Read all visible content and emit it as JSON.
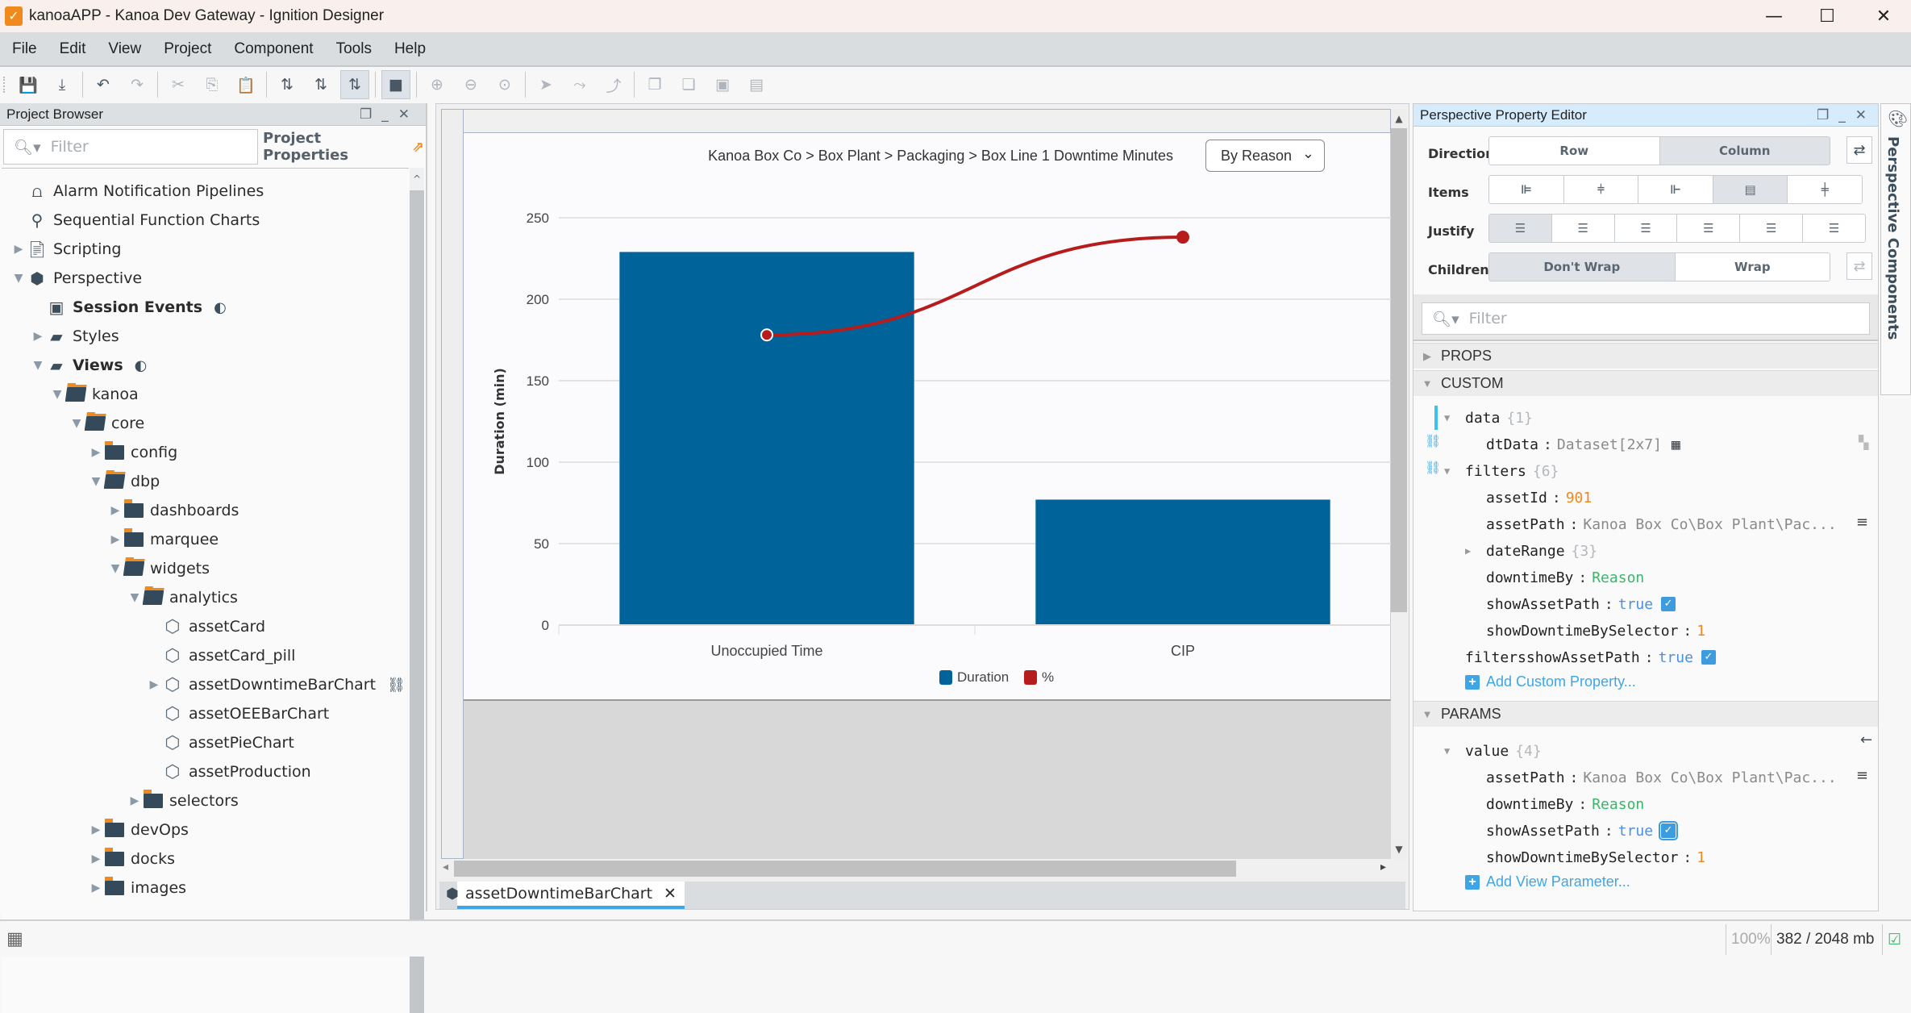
{
  "window": {
    "title": "kanoaAPP - Kanoa Dev Gateway - Ignition Designer",
    "controls": [
      "minimize-icon",
      "maximize-icon",
      "close-icon"
    ]
  },
  "menu": [
    "File",
    "Edit",
    "View",
    "Project",
    "Component",
    "Tools",
    "Help"
  ],
  "toolbar": {
    "groups": [
      [
        {
          "icon": "save-icon",
          "glyph": "💾"
        },
        {
          "icon": "save-download-icon",
          "glyph": "⤓"
        }
      ],
      [
        {
          "icon": "undo-icon",
          "glyph": "↶"
        },
        {
          "icon": "redo-icon",
          "glyph": "↷",
          "disabled": true
        }
      ],
      [
        {
          "icon": "cut-icon",
          "glyph": "✂",
          "disabled": true
        },
        {
          "icon": "copy-icon",
          "glyph": "⎘",
          "disabled": true
        },
        {
          "icon": "paste-icon",
          "glyph": "📋",
          "disabled": true
        }
      ],
      [
        {
          "icon": "binding-off-icon",
          "glyph": "⇅"
        },
        {
          "icon": "preview-mode-icon",
          "glyph": "⇅"
        },
        {
          "icon": "design-mode-icon",
          "glyph": "⇅",
          "active": true
        }
      ],
      [
        {
          "icon": "stop-icon",
          "glyph": "■",
          "active": true
        }
      ],
      [
        {
          "icon": "zoom-in-icon",
          "glyph": "⊕",
          "disabled": true
        },
        {
          "icon": "zoom-out-icon",
          "glyph": "⊖",
          "disabled": true
        },
        {
          "icon": "zoom-fit-icon",
          "glyph": "⊙",
          "disabled": true
        }
      ],
      [
        {
          "icon": "pointer-icon",
          "glyph": "➤",
          "disabled": true
        },
        {
          "icon": "connect-icon",
          "glyph": "⤳",
          "disabled": true
        },
        {
          "icon": "route-icon",
          "glyph": "⤴",
          "disabled": true
        }
      ],
      [
        {
          "icon": "bring-front-icon",
          "glyph": "❐",
          "disabled": true
        },
        {
          "icon": "send-back-icon",
          "glyph": "❏",
          "disabled": true
        },
        {
          "icon": "layer-up-icon",
          "glyph": "▣",
          "disabled": true
        },
        {
          "icon": "layer-down-icon",
          "glyph": "▤",
          "disabled": true
        }
      ]
    ]
  },
  "project_browser": {
    "title": "Project Browser",
    "filter_placeholder": "Filter",
    "project_properties_label": "Project Properties",
    "tree": [
      {
        "label": "Alarm Notification Pipelines",
        "depth": 0,
        "icon": "alarm-pipeline-icon",
        "arrow": ""
      },
      {
        "label": "Sequential Function Charts",
        "depth": 0,
        "icon": "sfc-icon",
        "arrow": ""
      },
      {
        "label": "Scripting",
        "depth": 0,
        "icon": "scripting-icon",
        "arrow": "collapsed"
      },
      {
        "label": "Perspective",
        "depth": 0,
        "icon": "perspective-icon",
        "arrow": "expanded"
      },
      {
        "label": "Session Events",
        "depth": 1,
        "icon": "session-events-icon",
        "arrow": "",
        "bold": true,
        "badge": true
      },
      {
        "label": "Styles",
        "depth": 1,
        "icon": "styles-folder-icon",
        "arrow": "collapsed"
      },
      {
        "label": "Views",
        "depth": 1,
        "icon": "views-folder-icon",
        "arrow": "expanded",
        "bold": true,
        "badge": true
      },
      {
        "label": "kanoa",
        "depth": 2,
        "icon": "folder-open-icon",
        "arrow": "expanded"
      },
      {
        "label": "core",
        "depth": 3,
        "icon": "folder-open-icon",
        "arrow": "expanded"
      },
      {
        "label": "config",
        "depth": 4,
        "icon": "folder-icon",
        "arrow": "collapsed"
      },
      {
        "label": "dbp",
        "depth": 4,
        "icon": "folder-open-icon",
        "arrow": "expanded"
      },
      {
        "label": "dashboards",
        "depth": 5,
        "icon": "folder-icon",
        "arrow": "collapsed"
      },
      {
        "label": "marquee",
        "depth": 5,
        "icon": "folder-icon",
        "arrow": "collapsed"
      },
      {
        "label": "widgets",
        "depth": 5,
        "icon": "folder-open-icon",
        "arrow": "expanded"
      },
      {
        "label": "analytics",
        "depth": 6,
        "icon": "folder-open-icon",
        "arrow": "expanded"
      },
      {
        "label": "assetCard",
        "depth": 7,
        "icon": "view-icon",
        "arrow": ""
      },
      {
        "label": "assetCard_pill",
        "depth": 7,
        "icon": "view-icon",
        "arrow": ""
      },
      {
        "label": "assetDowntimeBarChart",
        "depth": 7,
        "icon": "view-edit-icon",
        "arrow": "collapsed",
        "link": true
      },
      {
        "label": "assetOEEBarChart",
        "depth": 7,
        "icon": "view-icon",
        "arrow": ""
      },
      {
        "label": "assetPieChart",
        "depth": 7,
        "icon": "view-icon",
        "arrow": ""
      },
      {
        "label": "assetProduction",
        "depth": 7,
        "icon": "view-icon",
        "arrow": ""
      },
      {
        "label": "selectors",
        "depth": 6,
        "icon": "folder-icon",
        "arrow": "collapsed"
      },
      {
        "label": "devOps",
        "depth": 4,
        "icon": "folder-icon",
        "arrow": "collapsed"
      },
      {
        "label": "docks",
        "depth": 4,
        "icon": "folder-icon",
        "arrow": "collapsed"
      },
      {
        "label": "images",
        "depth": 4,
        "icon": "folder-icon",
        "arrow": "collapsed"
      }
    ]
  },
  "canvas": {
    "chart_title": "Kanoa Box Co > Box Plant > Packaging > Box Line 1 Downtime Minutes",
    "dropdown_value": "By Reason",
    "open_tab": "assetDowntimeBarChart"
  },
  "chart_data": {
    "type": "bar",
    "title": "Kanoa Box Co > Box Plant > Packaging > Box Line 1 Downtime Minutes",
    "categories": [
      "Unoccupied Time",
      "CIP"
    ],
    "series": [
      {
        "name": "Duration",
        "type": "bar",
        "color": "#006399",
        "values": [
          229,
          77
        ]
      },
      {
        "name": "%",
        "type": "line",
        "color": "#b71c1c",
        "axis": "secondary",
        "values": [
          74.8,
          100
        ]
      }
    ],
    "xlabel": "",
    "ylabel": "Duration (min)",
    "ylim": [
      0,
      250
    ],
    "yticks": [
      0,
      50,
      100,
      150,
      200,
      250
    ],
    "y2lim": [
      0,
      105
    ],
    "grid": true,
    "legend": "bottom"
  },
  "property_editor": {
    "title": "Perspective Property Editor",
    "direction": {
      "label": "Direction",
      "options": [
        "Row",
        "Column"
      ],
      "selected": "Column"
    },
    "items": {
      "label": "Items",
      "options": [
        "align-start-icon",
        "align-center-icon",
        "align-end-icon",
        "align-stretch-icon",
        "align-baseline-icon"
      ],
      "selected": 3
    },
    "justify": {
      "label": "Justify",
      "options": [
        "justify-start-icon",
        "justify-center-icon",
        "justify-end-icon",
        "justify-between-icon",
        "justify-around-icon",
        "justify-evenly-icon"
      ],
      "selected": 0
    },
    "children": {
      "label": "Children",
      "options": [
        "Don't Wrap",
        "Wrap"
      ],
      "selected": "Don't Wrap"
    },
    "filter_placeholder": "Filter",
    "sections": {
      "props": "PROPS",
      "custom": "CUSTOM",
      "params": "PARAMS"
    },
    "custom": {
      "data_key": "data",
      "data_count": "{1}",
      "dtData_key": "dtData",
      "dtData_value": "Dataset[2x7]",
      "filters_key": "filters",
      "filters_count": "{6}",
      "assetId_key": "assetId",
      "assetId_value": "901",
      "assetPath_key": "assetPath",
      "assetPath_value": "Kanoa Box Co\\Box Plant\\Pac...",
      "dateRange_key": "dateRange",
      "dateRange_count": "{3}",
      "downtimeBy_key": "downtimeBy",
      "downtimeBy_value": "Reason",
      "showAssetPath_key": "showAssetPath",
      "showAssetPath_value": "true",
      "showDowntimeBySelector_key": "showDowntimeBySelector",
      "showDowntimeBySelector_value": "1",
      "filtersshowAssetPath_key": "filtersshowAssetPath",
      "filtersshowAssetPath_value": "true",
      "add_label": "Add Custom Property..."
    },
    "params": {
      "value_key": "value",
      "value_count": "{4}",
      "assetPath_key": "assetPath",
      "assetPath_value": "Kanoa Box Co\\Box Plant\\Pac...",
      "downtimeBy_key": "downtimeBy",
      "downtimeBy_value": "Reason",
      "showAssetPath_key": "showAssetPath",
      "showAssetPath_value": "true",
      "showDowntimeBySelector_key": "showDowntimeBySelector",
      "showDowntimeBySelector_value": "1",
      "add_label": "Add View Parameter..."
    }
  },
  "right_strip": {
    "label": "Perspective Components"
  },
  "status": {
    "zoom": "100%",
    "memory": "382 / 2048 mb"
  }
}
